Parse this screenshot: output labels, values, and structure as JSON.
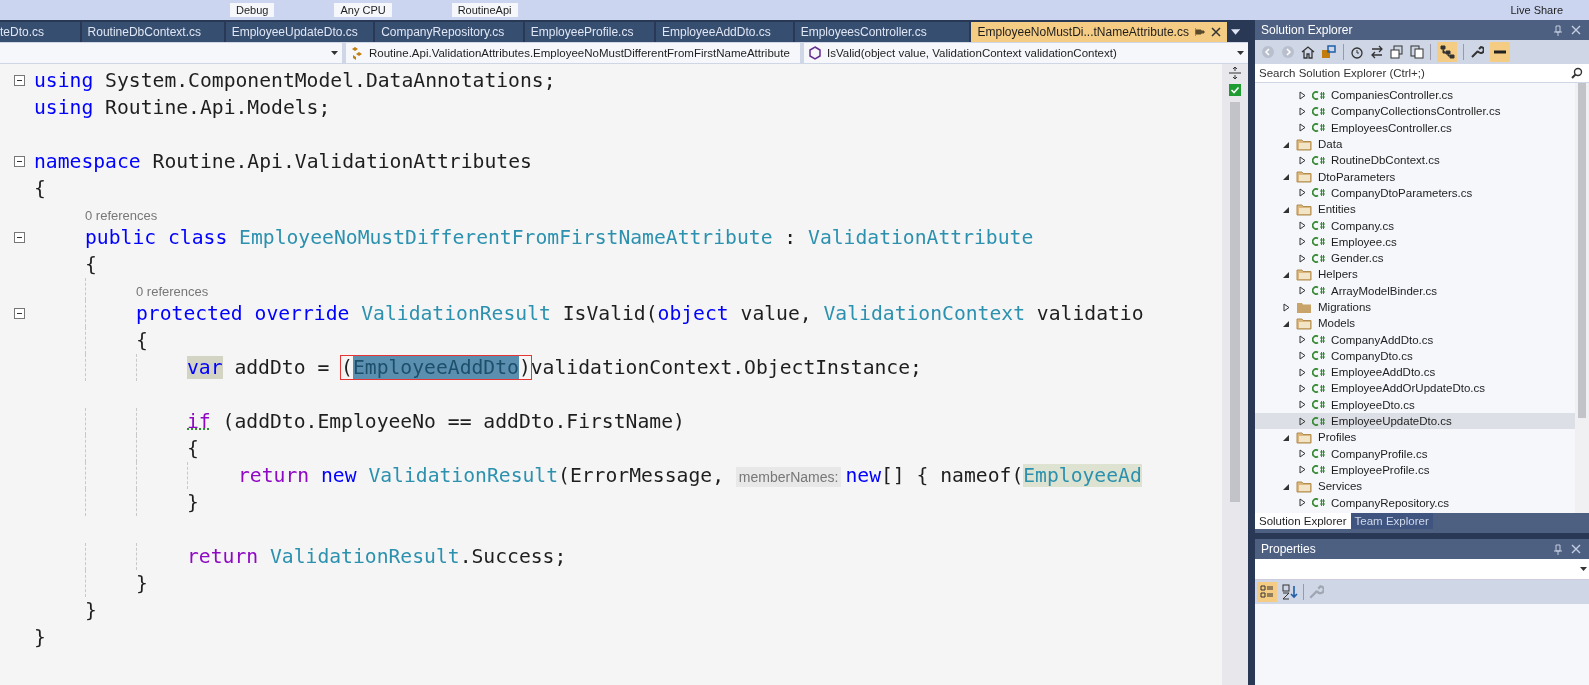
{
  "toolbar": {
    "items": [
      "Debug",
      "Any CPU",
      "RoutineApi"
    ],
    "live_share": "Live Share"
  },
  "tabs": [
    {
      "label": "teDto.cs",
      "selected": false
    },
    {
      "label": "RoutineDbContext.cs",
      "selected": false
    },
    {
      "label": "EmployeeUpdateDto.cs",
      "selected": false
    },
    {
      "label": "CompanyRepository.cs",
      "selected": false
    },
    {
      "label": "EmployeeProfile.cs",
      "selected": false
    },
    {
      "label": "EmployeeAddDto.cs",
      "selected": false
    },
    {
      "label": "EmployeesController.cs",
      "selected": false
    },
    {
      "label": "EmployeeNoMustDi...tNameAttribute.cs",
      "selected": true
    }
  ],
  "nav_bar": {
    "type": "Routine.Api.ValidationAttributes.EmployeeNoMustDifferentFromFirstNameAttribute",
    "member": "IsValid(object value, ValidationContext validationContext)"
  },
  "code": [
    {
      "kind": "code",
      "fold": true,
      "tokens": [
        {
          "kind": "kw",
          "text": "using"
        },
        {
          "kind": "plain",
          "text": " System.ComponentModel.DataAnnotations;"
        }
      ]
    },
    {
      "kind": "code",
      "tokens": [
        {
          "kind": "kw",
          "text": "using"
        },
        {
          "kind": "plain",
          "text": " Routine.Api.Models;"
        }
      ]
    },
    {
      "kind": "blank"
    },
    {
      "kind": "code",
      "fold": true,
      "tokens": [
        {
          "kind": "kw",
          "text": "namespace"
        },
        {
          "kind": "plain",
          "text": " Routine.Api.ValidationAttributes"
        }
      ]
    },
    {
      "kind": "code",
      "tokens": [
        {
          "kind": "plain",
          "text": "{"
        }
      ],
      "children": [
        {
          "kind": "codelens",
          "text": "0 references"
        },
        {
          "kind": "code",
          "fold": true,
          "tokens": [
            {
              "kind": "kw",
              "text": "public"
            },
            {
              "kind": "kw",
              "text": " class"
            },
            {
              "kind": "type",
              "text": " EmployeeNoMustDifferentFromFirstNameAttribute"
            },
            {
              "kind": "plain",
              "text": " : "
            },
            {
              "kind": "type",
              "text": "ValidationAttribute"
            }
          ]
        },
        {
          "kind": "code",
          "tokens": [
            {
              "kind": "plain",
              "text": "{"
            }
          ],
          "children": [
            {
              "kind": "codelens",
              "text": "0 references"
            },
            {
              "kind": "code",
              "fold": true,
              "tokens": [
                {
                  "kind": "kw",
                  "text": "protected"
                },
                {
                  "kind": "kw",
                  "text": " override"
                },
                {
                  "kind": "type",
                  "text": " ValidationResult"
                },
                {
                  "kind": "plain",
                  "text": " IsValid("
                },
                {
                  "kind": "kw",
                  "text": "object"
                },
                {
                  "kind": "plain",
                  "text": " value, "
                },
                {
                  "kind": "type",
                  "text": "ValidationContext"
                },
                {
                  "kind": "plain",
                  "text": " validatio"
                }
              ]
            },
            {
              "kind": "code",
              "tokens": [
                {
                  "kind": "plain",
                  "text": "{"
                }
              ],
              "children": [
                {
                  "kind": "code",
                  "tokens": [
                    {
                      "kind": "kw-marked",
                      "text": "var"
                    },
                    {
                      "kind": "plain",
                      "text": " addDto = "
                    },
                    {
                      "kind": "frame",
                      "tokens": [
                        {
                          "kind": "plain",
                          "text": "("
                        },
                        {
                          "kind": "type-selected",
                          "text": "EmployeeAddDto"
                        },
                        {
                          "kind": "plain",
                          "text": ")"
                        }
                      ]
                    },
                    {
                      "kind": "plain",
                      "text": "validationContext.ObjectInstance;"
                    }
                  ]
                },
                {
                  "kind": "blank"
                },
                {
                  "kind": "code",
                  "tokens": [
                    {
                      "kind": "ctl-squiggle",
                      "text": "if"
                    },
                    {
                      "kind": "plain",
                      "text": " (addDto.EmployeeNo == addDto.FirstName)"
                    }
                  ]
                },
                {
                  "kind": "code",
                  "tokens": [
                    {
                      "kind": "plain",
                      "text": "{"
                    }
                  ],
                  "children": [
                    {
                      "kind": "code",
                      "tokens": [
                        {
                          "kind": "ctl",
                          "text": "return"
                        },
                        {
                          "kind": "kw",
                          "text": " new"
                        },
                        {
                          "kind": "type",
                          "text": " ValidationResult"
                        },
                        {
                          "kind": "plain",
                          "text": "(ErrorMessage, "
                        },
                        {
                          "kind": "hint",
                          "text": "memberNames:"
                        },
                        {
                          "kind": "kw",
                          "text": "new"
                        },
                        {
                          "kind": "plain",
                          "text": "[] { nameof("
                        },
                        {
                          "kind": "type-marked",
                          "text": "EmployeeAd"
                        }
                      ]
                    }
                  ]
                },
                {
                  "kind": "code",
                  "tokens": [
                    {
                      "kind": "plain",
                      "text": "}"
                    }
                  ]
                },
                {
                  "kind": "blank"
                },
                {
                  "kind": "code",
                  "tokens": [
                    {
                      "kind": "ctl",
                      "text": "return"
                    },
                    {
                      "kind": "type",
                      "text": " ValidationResult"
                    },
                    {
                      "kind": "plain",
                      "text": ".Success;"
                    }
                  ]
                }
              ]
            },
            {
              "kind": "code",
              "tokens": [
                {
                  "kind": "plain",
                  "text": "}"
                }
              ]
            }
          ]
        },
        {
          "kind": "code",
          "tokens": [
            {
              "kind": "plain",
              "text": "}"
            }
          ]
        }
      ]
    },
    {
      "kind": "code",
      "tokens": [
        {
          "kind": "plain",
          "text": "}"
        }
      ]
    }
  ],
  "solution_explorer": {
    "title": "Solution Explorer",
    "search": {
      "placeholder": "Search Solution Explorer (Ctrl+;)"
    },
    "tree": [
      {
        "kind": "file",
        "label": "CompaniesController.cs",
        "selected": false
      },
      {
        "kind": "file",
        "label": "CompanyCollectionsController.cs",
        "selected": false
      },
      {
        "kind": "file",
        "label": "EmployeesController.cs",
        "selected": false
      },
      {
        "kind": "folder",
        "label": "Data",
        "expanded": true,
        "selected": false,
        "children": [
          {
            "kind": "file",
            "label": "RoutineDbContext.cs",
            "selected": false
          }
        ]
      },
      {
        "kind": "folder",
        "label": "DtoParameters",
        "expanded": true,
        "selected": false,
        "children": [
          {
            "kind": "file",
            "label": "CompanyDtoParameters.cs",
            "selected": false
          }
        ]
      },
      {
        "kind": "folder",
        "label": "Entities",
        "expanded": true,
        "selected": false,
        "children": [
          {
            "kind": "file",
            "label": "Company.cs",
            "selected": false
          },
          {
            "kind": "file",
            "label": "Employee.cs",
            "selected": false
          },
          {
            "kind": "file",
            "label": "Gender.cs",
            "selected": false
          }
        ]
      },
      {
        "kind": "folder",
        "label": "Helpers",
        "expanded": true,
        "selected": false,
        "children": [
          {
            "kind": "file",
            "label": "ArrayModelBinder.cs",
            "selected": false
          }
        ]
      },
      {
        "kind": "folder",
        "label": "Migrations",
        "expanded": false,
        "selected": false
      },
      {
        "kind": "folder",
        "label": "Models",
        "expanded": true,
        "selected": false,
        "children": [
          {
            "kind": "file",
            "label": "CompanyAddDto.cs",
            "selected": false
          },
          {
            "kind": "file",
            "label": "CompanyDto.cs",
            "selected": false
          },
          {
            "kind": "file",
            "label": "EmployeeAddDto.cs",
            "selected": false
          },
          {
            "kind": "file",
            "label": "EmployeeAddOrUpdateDto.cs",
            "selected": false
          },
          {
            "kind": "file",
            "label": "EmployeeDto.cs",
            "selected": false
          },
          {
            "kind": "file",
            "label": "EmployeeUpdateDto.cs",
            "selected": true
          }
        ]
      },
      {
        "kind": "folder",
        "label": "Profiles",
        "expanded": true,
        "selected": false,
        "children": [
          {
            "kind": "file",
            "label": "CompanyProfile.cs",
            "selected": false
          },
          {
            "kind": "file",
            "label": "EmployeeProfile.cs",
            "selected": false
          }
        ]
      },
      {
        "kind": "folder",
        "label": "Services",
        "expanded": true,
        "selected": false,
        "children": [
          {
            "kind": "file",
            "label": "CompanyRepository.cs",
            "selected": false
          }
        ]
      }
    ],
    "bottom_tabs": [
      {
        "label": "Solution Explorer",
        "selected": true
      },
      {
        "label": "Team Explorer",
        "selected": false
      }
    ]
  },
  "properties": {
    "title": "Properties"
  }
}
